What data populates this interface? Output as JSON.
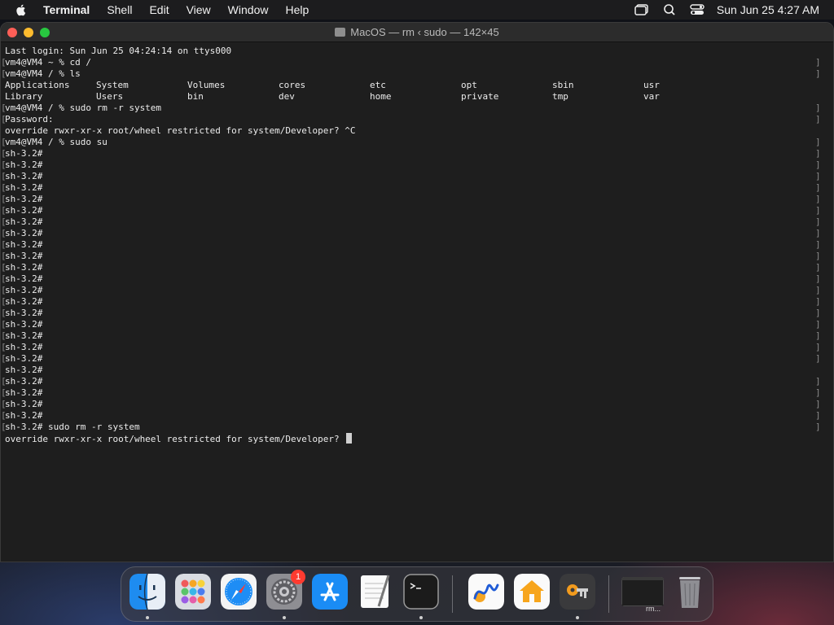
{
  "menubar": {
    "app_name": "Terminal",
    "items": [
      "Shell",
      "Edit",
      "View",
      "Window",
      "Help"
    ],
    "clock": "Sun Jun 25  4:27 AM"
  },
  "window": {
    "title": "MacOS — rm ‹ sudo — 142×45"
  },
  "terminal": {
    "lines": [
      {
        "text": "Last login: Sun Jun 25 04:24:14 on ttys000",
        "bracket": false
      },
      {
        "text": "vm4@VM4 ~ % cd /",
        "bracket": true
      },
      {
        "text": "vm4@VM4 / % ls",
        "bracket": true
      },
      {
        "ls": [
          "Applications",
          "System",
          "Volumes",
          "cores",
          "etc",
          "opt",
          "sbin",
          "usr"
        ]
      },
      {
        "ls": [
          "Library",
          "Users",
          "bin",
          "dev",
          "home",
          "private",
          "tmp",
          "var"
        ]
      },
      {
        "text": "vm4@VM4 / % sudo rm -r system",
        "bracket": true
      },
      {
        "text": "Password:",
        "bracket": true
      },
      {
        "text": "override rwxr-xr-x root/wheel restricted for system/Developer? ^C",
        "bracket": false
      },
      {
        "text": "vm4@VM4 / % sudo su",
        "bracket": true
      },
      {
        "text": "sh-3.2#",
        "bracket": true
      },
      {
        "text": "sh-3.2#",
        "bracket": true
      },
      {
        "text": "sh-3.2#",
        "bracket": true
      },
      {
        "text": "sh-3.2#",
        "bracket": true
      },
      {
        "text": "sh-3.2#",
        "bracket": true
      },
      {
        "text": "sh-3.2#",
        "bracket": true
      },
      {
        "text": "sh-3.2#",
        "bracket": true
      },
      {
        "text": "sh-3.2#",
        "bracket": true
      },
      {
        "text": "sh-3.2#",
        "bracket": true
      },
      {
        "text": "sh-3.2#",
        "bracket": true
      },
      {
        "text": "sh-3.2#",
        "bracket": true
      },
      {
        "text": "sh-3.2#",
        "bracket": true
      },
      {
        "text": "sh-3.2#",
        "bracket": true
      },
      {
        "text": "sh-3.2#",
        "bracket": true
      },
      {
        "text": "sh-3.2#",
        "bracket": true
      },
      {
        "text": "sh-3.2#",
        "bracket": true
      },
      {
        "text": "sh-3.2#",
        "bracket": true
      },
      {
        "text": "sh-3.2#",
        "bracket": true
      },
      {
        "text": "sh-3.2#",
        "bracket": true
      },
      {
        "text": "sh-3.2#",
        "bracket": false
      },
      {
        "text": "sh-3.2#",
        "bracket": true
      },
      {
        "text": "sh-3.2#",
        "bracket": true
      },
      {
        "text": "sh-3.2#",
        "bracket": true
      },
      {
        "text": "sh-3.2#",
        "bracket": true
      },
      {
        "text": "sh-3.2# sudo rm -r system",
        "bracket": true
      },
      {
        "text": "override rwxr-xr-x root/wheel restricted for system/Developer? ",
        "bracket": false,
        "cursor": true
      }
    ]
  },
  "dock": {
    "items": [
      {
        "name": "finder-icon",
        "running": true
      },
      {
        "name": "launchpad-icon",
        "running": false
      },
      {
        "name": "safari-icon",
        "running": false
      },
      {
        "name": "system-settings-icon",
        "running": true,
        "badge": "1"
      },
      {
        "name": "app-store-icon",
        "running": false
      },
      {
        "name": "textedit-icon",
        "running": false
      },
      {
        "name": "terminal-icon",
        "running": true
      },
      {
        "name": "freeform-icon",
        "running": false
      },
      {
        "name": "home-icon",
        "running": false
      },
      {
        "name": "keychain-access-icon",
        "running": true
      },
      {
        "name": "minimized-window-thumbnail",
        "running": false,
        "label": "rm..."
      },
      {
        "name": "trash-icon",
        "running": false
      }
    ]
  }
}
